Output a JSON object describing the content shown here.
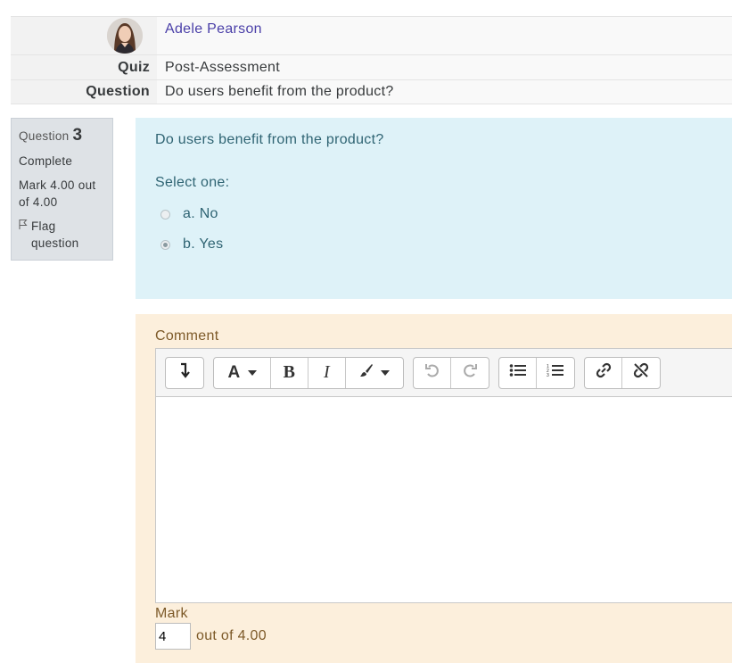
{
  "summary": {
    "user_name": "Adele Pearson",
    "quiz_label": "Quiz",
    "quiz_value": "Post-Assessment",
    "question_label": "Question",
    "question_value": "Do users benefit from the product?"
  },
  "qinfo": {
    "question_label": "Question",
    "question_number": "3",
    "state": "Complete",
    "grade": "Mark 4.00 out of 4.00",
    "flag_label": "Flag question"
  },
  "formulation": {
    "question_text": "Do users benefit from the product?",
    "prompt": "Select one:",
    "answers": [
      {
        "label": "a. No",
        "checked": false
      },
      {
        "label": "b. Yes",
        "checked": true
      }
    ]
  },
  "comment": {
    "label": "Comment",
    "toolbar_icons": [
      "expand-toolbar-icon",
      "font-icon",
      "bold-icon",
      "italic-icon",
      "brush-icon",
      "undo-icon",
      "redo-icon",
      "bulleted-list-icon",
      "numbered-list-icon",
      "link-icon",
      "unlink-icon"
    ],
    "mark_label": "Mark",
    "mark_value": "4",
    "mark_out_of": "out of 4.00"
  },
  "colors": {
    "formulation_bg": "#def2f8",
    "formulation_text": "#2f6473",
    "comment_bg": "#fcefdc",
    "comment_text": "#7d5a29",
    "link": "#4a3fa8"
  }
}
